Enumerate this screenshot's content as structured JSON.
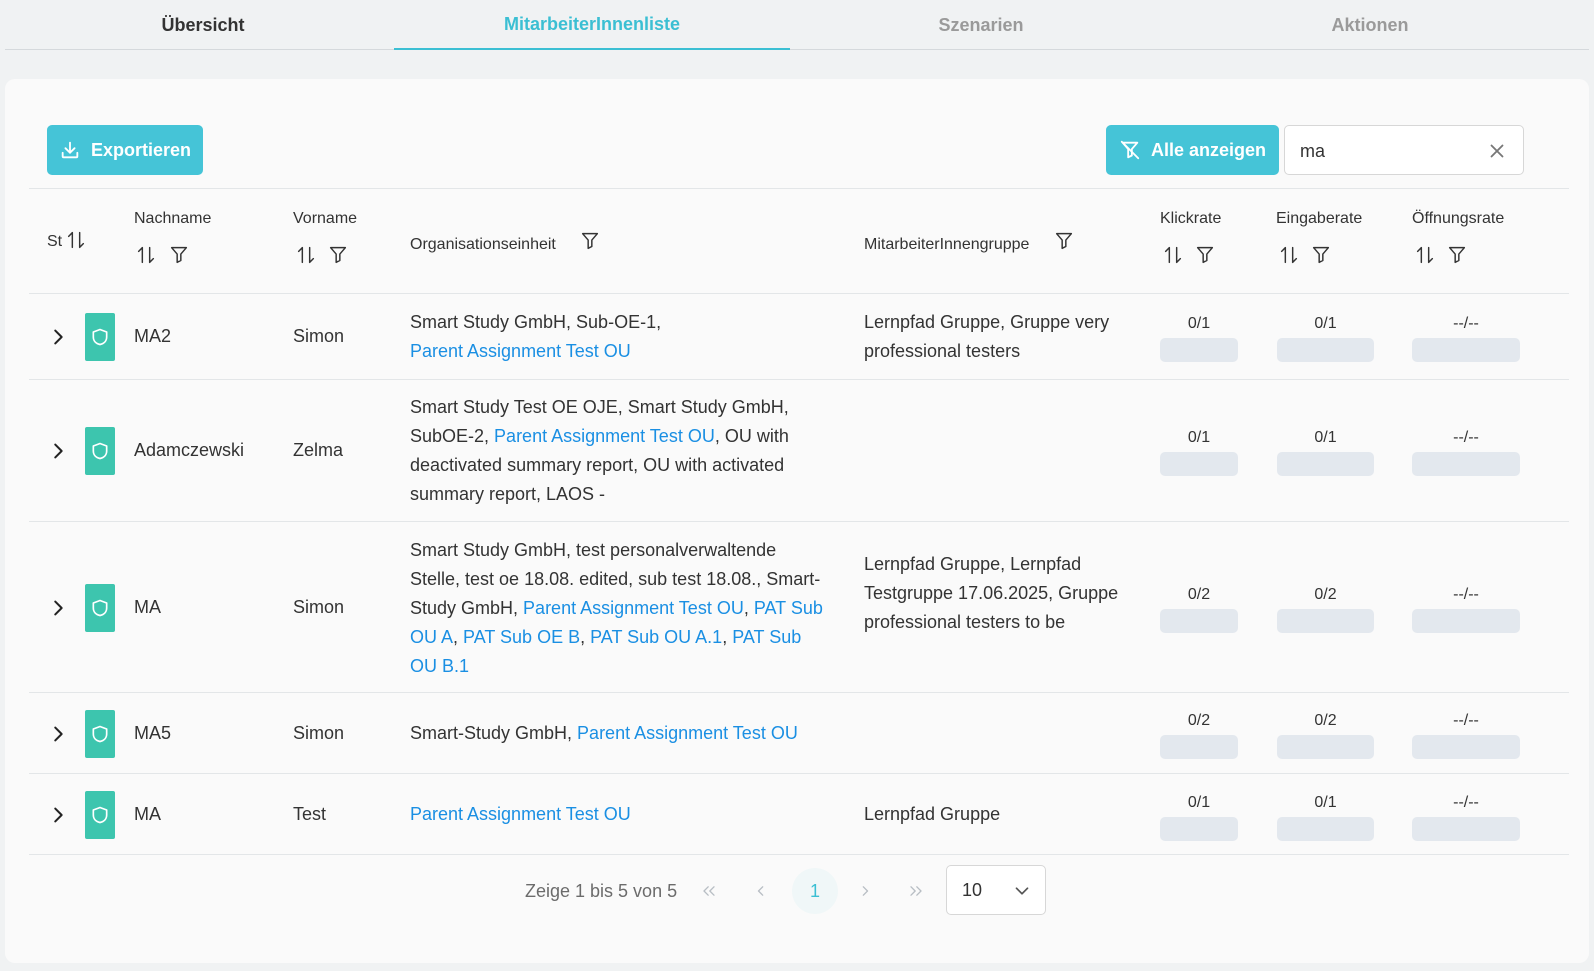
{
  "tabs": [
    "Übersicht",
    "MitarbeiterInnenliste",
    "Szenarien",
    "Aktionen"
  ],
  "toolbar": {
    "export_label": "Exportieren",
    "show_all_label": "Alle anzeigen"
  },
  "search": {
    "value": "ma"
  },
  "columns": {
    "status": "St",
    "lastname": "Nachname",
    "firstname": "Vorname",
    "orgunit": "Organisationseinheit",
    "group": "MitarbeiterInnengruppe",
    "clickrate": "Klickrate",
    "inputrate": "Eingaberate",
    "openrate": "Öffnungsrate"
  },
  "rows": [
    {
      "lastname": "MA2",
      "firstname": "Simon",
      "org": [
        {
          "text": "Smart Study GmbH, Sub-OE-1,",
          "link": false
        },
        {
          "text": "\n",
          "link": false
        },
        {
          "text": "Parent Assignment Test OU",
          "link": true
        }
      ],
      "group": "Lernpfad Gruppe, Gruppe very professional testers",
      "clickrate": "0/1",
      "inputrate": "0/1",
      "openrate": "--/--"
    },
    {
      "lastname": "Adamczewski",
      "firstname": "Zelma",
      "org": [
        {
          "text": "Smart Study Test OE OJE, Smart Study GmbH, SubOE-2, ",
          "link": false
        },
        {
          "text": "Parent Assignment Test OU",
          "link": true
        },
        {
          "text": ", OU with deactivated summary report, OU with activated summary report, LAOS -",
          "link": false
        }
      ],
      "group": "",
      "clickrate": "0/1",
      "inputrate": "0/1",
      "openrate": "--/--"
    },
    {
      "lastname": "MA",
      "firstname": "Simon",
      "org": [
        {
          "text": "Smart Study GmbH, test personalverwaltende Stelle, test oe 18.08. edited, sub test 18.08., Smart-Study GmbH, ",
          "link": false
        },
        {
          "text": "Parent Assignment Test OU",
          "link": true
        },
        {
          "text": ", ",
          "link": false
        },
        {
          "text": "PAT Sub OU A",
          "link": true
        },
        {
          "text": ", ",
          "link": false
        },
        {
          "text": "PAT Sub OE B",
          "link": true
        },
        {
          "text": ", ",
          "link": false
        },
        {
          "text": "PAT Sub OU A.1",
          "link": true
        },
        {
          "text": ", ",
          "link": false
        },
        {
          "text": "PAT Sub OU B.1",
          "link": true
        }
      ],
      "group": "Lernpfad Gruppe, Lernpfad Testgruppe 17.06.2025, Gruppe professional testers to be",
      "clickrate": "0/2",
      "inputrate": "0/2",
      "openrate": "--/--"
    },
    {
      "lastname": "MA5",
      "firstname": "Simon",
      "org": [
        {
          "text": "Smart-Study GmbH, ",
          "link": false
        },
        {
          "text": "Parent Assignment Test OU",
          "link": true
        }
      ],
      "group": "",
      "clickrate": "0/2",
      "inputrate": "0/2",
      "openrate": "--/--"
    },
    {
      "lastname": "MA",
      "firstname": "Test",
      "org": [
        {
          "text": "Parent Assignment Test OU",
          "link": true
        }
      ],
      "group": "Lernpfad Gruppe",
      "clickrate": "0/1",
      "inputrate": "0/1",
      "openrate": "--/--"
    }
  ],
  "pagination": {
    "summary": "Zeige 1 bis 5 von 5",
    "current_page": "1",
    "page_size": "10"
  },
  "colors": {
    "accent": "#45c4d7",
    "shield": "#3dc5ae",
    "link": "#1a8fe3"
  }
}
